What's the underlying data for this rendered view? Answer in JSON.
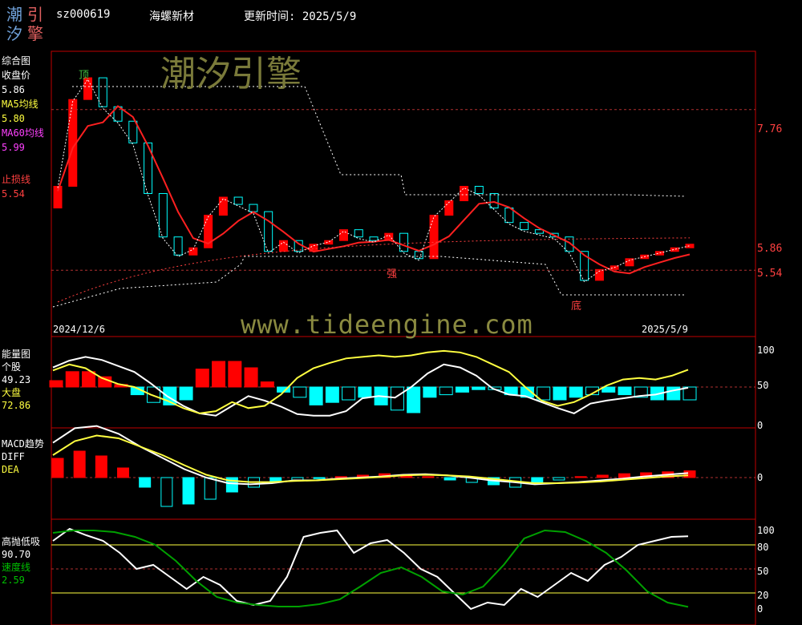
{
  "header": {
    "logo_chars": [
      "潮",
      "引",
      "汐",
      "擎"
    ],
    "code": "sz000619",
    "name": "海螺新材",
    "update_label": "更新时间: 2025/5/9"
  },
  "watermarks": {
    "brand": "潮汐引擎",
    "url": "www.tideengine.com"
  },
  "colors": {
    "up": "#ff0000",
    "down": "#00ffff",
    "price_line": "#ff2020",
    "yellow": "#ffff40",
    "green": "#00a000",
    "frame": "#c00000",
    "cyan_text": "#00ffff"
  },
  "panel_main": {
    "labels": [
      {
        "text": "综合图",
        "color": "#ffffff"
      },
      {
        "text": "收盘价",
        "color": "#ffffff"
      },
      {
        "text": "5.86",
        "color": "#ffffff"
      },
      {
        "text": "MA5均线",
        "color": "#ffff40"
      },
      {
        "text": "5.80",
        "color": "#ffff40"
      },
      {
        "text": "MA60均线",
        "color": "#ff40ff"
      },
      {
        "text": "5.99",
        "color": "#ff40ff"
      }
    ],
    "stop_label": "止损线",
    "stop_value": "5.54",
    "date_start": "2024/12/6",
    "date_end": "2025/5/9",
    "axis": [
      "7.76",
      "5.86",
      "5.54"
    ],
    "annotations": [
      "顶",
      "强",
      "底"
    ]
  },
  "panel_energy": {
    "labels": [
      {
        "text": "能量图",
        "color": "#ffffff"
      },
      {
        "text": "个股",
        "color": "#ffffff"
      },
      {
        "text": "49.23",
        "color": "#ffffff"
      },
      {
        "text": "大盘",
        "color": "#ffff40"
      },
      {
        "text": "72.86",
        "color": "#ffff40"
      }
    ],
    "axis": [
      "100",
      "50",
      "0"
    ]
  },
  "panel_macd": {
    "labels": [
      {
        "text": "MACD趋势",
        "color": "#ffffff"
      },
      {
        "text": "DIFF",
        "color": "#ffffff"
      },
      {
        "text": "DEA",
        "color": "#ffff40"
      }
    ],
    "axis": [
      "0"
    ]
  },
  "panel_kdj": {
    "labels": [
      {
        "text": "高抛低吸",
        "color": "#ffffff"
      },
      {
        "text": "90.70",
        "color": "#ffffff"
      },
      {
        "text": "速度线",
        "color": "#00c000"
      },
      {
        "text": "2.59",
        "color": "#00c000"
      }
    ],
    "axis": [
      "100",
      "80",
      "50",
      "20",
      "0"
    ]
  },
  "chart_data": [
    {
      "type": "candlestick",
      "price_scale_marks": [
        7.76,
        5.86,
        5.54
      ],
      "close": [
        6.7,
        7.9,
        8.2,
        7.8,
        7.6,
        7.3,
        6.6,
        6.0,
        5.75,
        5.85,
        6.3,
        6.55,
        6.45,
        6.35,
        5.8,
        5.95,
        5.8,
        5.9,
        5.95,
        6.1,
        6.0,
        5.95,
        6.05,
        5.8,
        5.7,
        6.3,
        6.5,
        6.7,
        6.6,
        6.4,
        6.2,
        6.1,
        6.05,
        6.0,
        5.8,
        5.4,
        5.55,
        5.6,
        5.7,
        5.75,
        5.8,
        5.85,
        5.9
      ],
      "MA5": 5.8,
      "MA60": 5.99,
      "stop_line": 5.54,
      "last_close": 5.86
    },
    {
      "type": "bar",
      "name": "energy",
      "ylim": [
        0,
        100
      ],
      "reference": 50,
      "series": [
        {
          "name": "个股",
          "last": 49.23,
          "values": [
            76,
            85,
            90,
            86,
            78,
            70,
            55,
            38,
            25,
            15,
            12,
            25,
            38,
            32,
            24,
            14,
            12,
            12,
            18,
            35,
            38,
            36,
            50,
            68,
            80,
            76,
            65,
            48,
            40,
            38,
            30,
            22,
            15,
            28,
            32,
            35,
            38,
            40,
            45,
            49
          ]
        },
        {
          "name": "大盘",
          "last": 72.86,
          "values": [
            72,
            80,
            75,
            62,
            54,
            50,
            40,
            32,
            22,
            15,
            18,
            30,
            22,
            25,
            40,
            62,
            75,
            82,
            88,
            90,
            92,
            90,
            92,
            96,
            98,
            96,
            90,
            80,
            70,
            50,
            32,
            25,
            30,
            40,
            52,
            60,
            62,
            60,
            65,
            73
          ]
        }
      ],
      "bars": [
        5,
        12,
        12,
        8,
        2,
        -6,
        -12,
        -14,
        -10,
        14,
        20,
        20,
        15,
        4,
        -4,
        -8,
        -14,
        -12,
        -10,
        -8,
        -14,
        -18,
        -20,
        -8,
        -6,
        -4,
        -2,
        -2,
        -6,
        -8,
        -10,
        -10,
        -8,
        -6,
        -4,
        -6,
        -8,
        -10,
        -10,
        -10
      ]
    },
    {
      "type": "bar",
      "name": "MACD",
      "series": [
        {
          "name": "DIFF",
          "values": [
            0.62,
            0.88,
            0.92,
            0.78,
            0.55,
            0.35,
            0.15,
            0.0,
            -0.1,
            -0.12,
            -0.1,
            -0.05,
            -0.05,
            -0.02,
            0.0,
            0.02,
            0.05,
            0.06,
            0.04,
            0.0,
            -0.05,
            -0.08,
            -0.12,
            -0.1,
            -0.08,
            -0.05,
            -0.02,
            0.02,
            0.05,
            0.08
          ]
        },
        {
          "name": "DEA",
          "values": [
            0.4,
            0.65,
            0.75,
            0.7,
            0.55,
            0.4,
            0.22,
            0.05,
            -0.05,
            -0.08,
            -0.08,
            -0.06,
            -0.05,
            -0.03,
            -0.01,
            0.01,
            0.04,
            0.05,
            0.04,
            0.02,
            -0.02,
            -0.06,
            -0.1,
            -0.1,
            -0.09,
            -0.07,
            -0.04,
            -0.01,
            0.02,
            0.04
          ]
        }
      ],
      "bars": [
        0.4,
        0.55,
        0.45,
        0.2,
        -0.2,
        -0.6,
        -0.55,
        -0.45,
        -0.3,
        -0.2,
        -0.1,
        -0.05,
        -0.02,
        0.02,
        0.05,
        0.08,
        0.06,
        0.02,
        -0.05,
        -0.1,
        -0.15,
        -0.2,
        -0.12,
        -0.05,
        0.02,
        0.05,
        0.08,
        0.1,
        0.12,
        0.14
      ]
    },
    {
      "type": "line",
      "name": "高抛低吸",
      "ylim": [
        0,
        100
      ],
      "reference_levels": [
        80,
        50,
        20
      ],
      "series": [
        {
          "name": "高抛低吸",
          "last": 90.7,
          "values": [
            85,
            100,
            92,
            85,
            70,
            50,
            55,
            40,
            25,
            40,
            30,
            10,
            5,
            10,
            40,
            90,
            95,
            98,
            70,
            82,
            86,
            70,
            50,
            40,
            20,
            0,
            8,
            5,
            25,
            15,
            30,
            45,
            35,
            55,
            65,
            80,
            85,
            90,
            90.7
          ]
        },
        {
          "name": "速度线",
          "last": 2.59,
          "values": [
            95,
            98,
            98,
            96,
            90,
            80,
            60,
            35,
            15,
            8,
            5,
            3,
            3,
            6,
            12,
            28,
            45,
            52,
            40,
            22,
            18,
            28,
            55,
            88,
            98,
            96,
            85,
            70,
            48,
            22,
            8,
            2.59
          ]
        }
      ]
    }
  ]
}
